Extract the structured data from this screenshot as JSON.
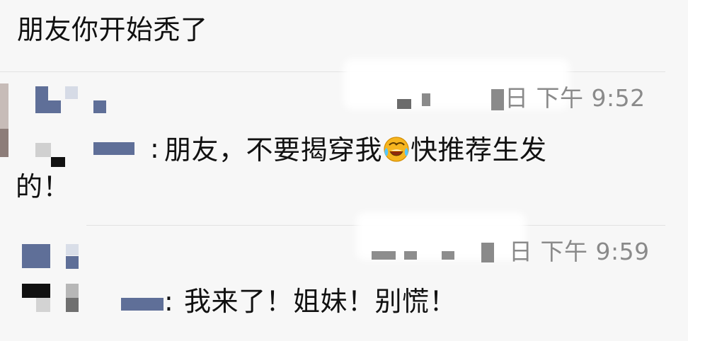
{
  "header_text": "朋友你开始秃了",
  "messages": [
    {
      "name_suffix": ":",
      "time": "日 下午 9:52",
      "text_line1_a": "朋友，不要揭穿我",
      "emoji": "face-with-tears-of-joy-icon",
      "text_line1_b": "快推荐生发",
      "text_line2": "的！"
    },
    {
      "name_suffix": ":",
      "time": "日 下午 9:59",
      "text_line1": "我来了！姐妹！别慌！"
    }
  ],
  "colors": {
    "panel": "#f7f7f7",
    "text": "#111111",
    "meta": "#8a8a8a",
    "blue_pixel": "#5f6f98",
    "gray_pixel": "#b9b9b9",
    "dark_pixel": "#111111",
    "brown_pixel": "#9b8b86"
  }
}
